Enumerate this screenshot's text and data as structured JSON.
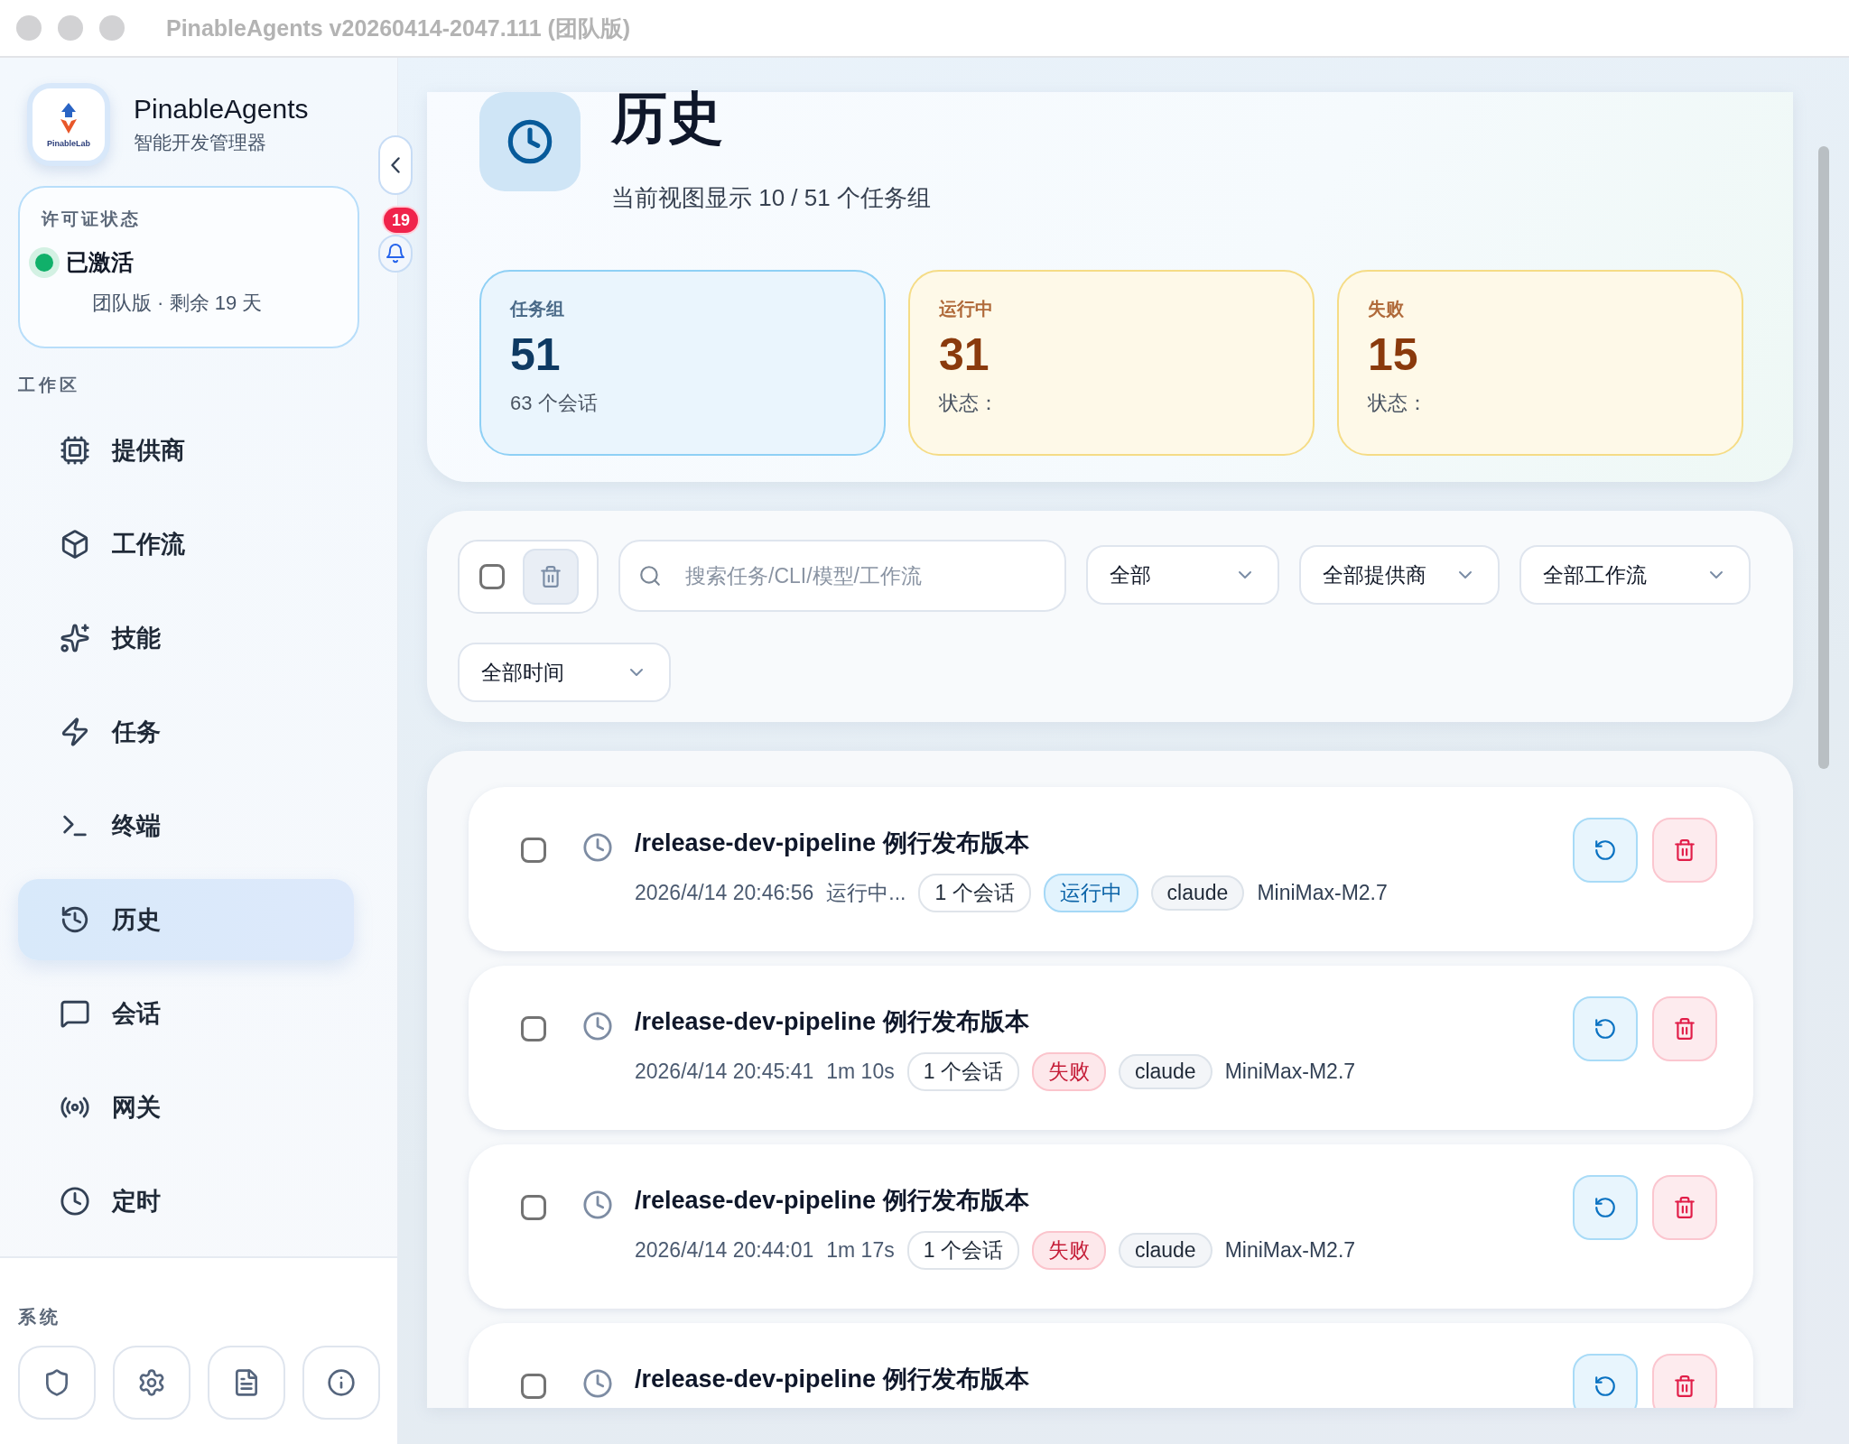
{
  "window": {
    "title": "PinableAgents v20260414-2047.111 (团队版)"
  },
  "sidebar": {
    "logo_text": "PinableLab",
    "app_name": "PinableAgents",
    "app_subtitle": "智能开发管理器",
    "license": {
      "label": "许可证状态",
      "status": "已激活",
      "active": true,
      "detail": "团队版 · 剩余 19 天"
    },
    "notification_count": "19",
    "section_label": "工作区",
    "items": [
      {
        "label": "提供商",
        "selected": false
      },
      {
        "label": "工作流",
        "selected": false
      },
      {
        "label": "技能",
        "selected": false
      },
      {
        "label": "任务",
        "selected": false
      },
      {
        "label": "终端",
        "selected": false
      },
      {
        "label": "历史",
        "selected": true
      },
      {
        "label": "会话",
        "selected": false
      },
      {
        "label": "网关",
        "selected": false
      },
      {
        "label": "定时",
        "selected": false
      }
    ],
    "system_label": "系统"
  },
  "header": {
    "title": "历史",
    "subtitle": "当前视图显示 10 / 51 个任务组"
  },
  "stats": [
    {
      "label": "任务组",
      "value": "51",
      "sub": "63 个会话",
      "kind": "info"
    },
    {
      "label": "运行中",
      "value": "31",
      "sub": "状态：",
      "kind": "warning"
    },
    {
      "label": "失败",
      "value": "15",
      "sub": "状态：",
      "kind": "warning"
    }
  ],
  "filters": {
    "select_all": {
      "checked": false
    },
    "search": {
      "placeholder": "搜索任务/CLI/模型/工作流"
    },
    "dropdowns": [
      "全部",
      "全部提供商",
      "全部工作流",
      "全部时间"
    ]
  },
  "tasks": [
    {
      "title": "/release-dev-pipeline 例行发布版本",
      "checked": false,
      "time": "2026/4/14 20:46:56",
      "duration": "运行中...",
      "sessions": "1 个会话",
      "status": {
        "label": "运行中",
        "kind": "running"
      },
      "cli": "claude",
      "model": "MiniMax-M2.7"
    },
    {
      "title": "/release-dev-pipeline 例行发布版本",
      "checked": false,
      "time": "2026/4/14 20:45:41",
      "duration": "1m 10s",
      "sessions": "1 个会话",
      "status": {
        "label": "失败",
        "kind": "failed"
      },
      "cli": "claude",
      "model": "MiniMax-M2.7"
    },
    {
      "title": "/release-dev-pipeline 例行发布版本",
      "checked": false,
      "time": "2026/4/14 20:44:01",
      "duration": "1m 17s",
      "sessions": "1 个会话",
      "status": {
        "label": "失败",
        "kind": "failed"
      },
      "cli": "claude",
      "model": "MiniMax-M2.7"
    },
    {
      "title": "/release-dev-pipeline 例行发布版本",
      "checked": false
    }
  ]
}
